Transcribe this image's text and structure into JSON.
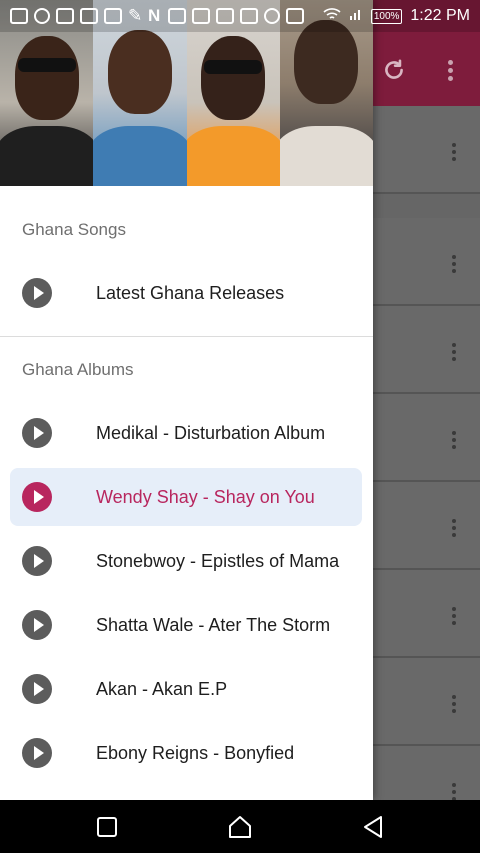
{
  "status_bar": {
    "time": "1:22 PM",
    "battery": "100%",
    "notification_icons": [
      "plus-box-icon",
      "swirl-icon",
      "shirt-icon",
      "mail-icon",
      "message-icon",
      "wrench-icon",
      "n-icon",
      "scan-icon",
      "calendar-icon",
      "phone-icon",
      "youtube-icon",
      "instagram-icon",
      "facebook-icon"
    ]
  },
  "drawer": {
    "sections": [
      {
        "title": "Ghana Songs",
        "items": [
          {
            "label": "Latest Ghana Releases",
            "icon": "play-circle-icon",
            "active": false
          }
        ]
      },
      {
        "title": "Ghana Albums",
        "items": [
          {
            "label": "Medikal - Disturbation Album",
            "icon": "play-circle-icon",
            "active": false
          },
          {
            "label": "Wendy Shay - Shay on You",
            "icon": "play-circle-icon",
            "active": true
          },
          {
            "label": "Stonebwoy - Epistles of Mama",
            "icon": "play-circle-icon",
            "active": false
          },
          {
            "label": "Shatta Wale - Ater The Storm",
            "icon": "play-circle-icon",
            "active": false
          },
          {
            "label": "Akan - Akan E.P",
            "icon": "play-circle-icon",
            "active": false
          },
          {
            "label": "Ebony Reigns - Bonyfied",
            "icon": "play-circle-icon",
            "active": false
          }
        ]
      }
    ]
  },
  "toolbar": {
    "actions": [
      "refresh-icon",
      "overflow-menu-icon"
    ]
  },
  "colors": {
    "toolbar": "#7e1c3c",
    "active_accent": "#b8265e",
    "active_bg": "#e6eef9"
  },
  "system_nav": [
    "recent-apps-icon",
    "home-icon",
    "back-icon"
  ]
}
